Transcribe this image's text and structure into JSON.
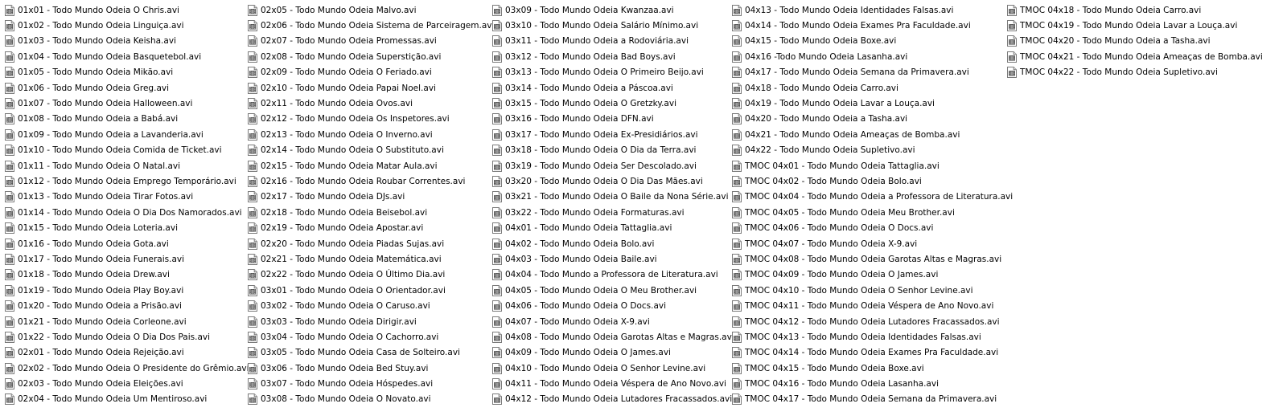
{
  "file_icon": "video-file-icon",
  "columns": [
    [
      "01x01 - Todo Mundo Odeia O Chris.avi",
      "01x02 - Todo Mundo Odeia Linguiça.avi",
      "01x03 - Todo Mundo Odeia Keisha.avi",
      "01x04 - Todo Mundo Odeia Basquetebol.avi",
      "01x05 - Todo Mundo Odeia Mikão.avi",
      "01x06 - Todo Mundo Odeia Greg.avi",
      "01x07 - Todo Mundo Odeia Halloween.avi",
      "01x08 - Todo Mundo Odeia a Babá.avi",
      "01x09 - Todo Mundo Odeia a Lavanderia.avi",
      "01x10 - Todo Mundo Odeia Comida de Ticket.avi",
      "01x11 - Todo Mundo Odeia O Natal.avi",
      "01x12 - Todo Mundo Odeia Emprego Temporário.avi",
      "01x13 - Todo Mundo Odeia Tirar Fotos.avi",
      "01x14 - Todo Mundo Odeia O Dia Dos Namorados.avi",
      "01x15 - Todo Mundo Odeia Loteria.avi",
      "01x16 - Todo Mundo Odeia Gota.avi",
      "01x17 - Todo Mundo Odeia Funerais.avi",
      "01x18 - Todo Mundo Odeia Drew.avi",
      "01x19 - Todo Mundo Odeia Play Boy.avi",
      "01x20 - Todo Mundo Odeia a Prisão.avi",
      "01x21 - Todo Mundo Odeia Corleone.avi",
      "01x22 - Todo Mundo Odeia O Dia Dos Pais.avi",
      "02x01 - Todo Mundo Odeia Rejeição.avi",
      "02x02 - Todo Mundo Odeia O Presidente do Grêmio.avi",
      "02x03 - Todo Mundo Odeia Eleições.avi",
      "02x04 - Todo Mundo Odeia Um Mentiroso.avi"
    ],
    [
      "02x05 - Todo Mundo Odeia Malvo.avi",
      "02x06 - Todo Mundo Odeia Sistema de Parceiragem.avi",
      "02x07 - Todo Mundo Odeia Promessas.avi",
      "02x08 - Todo Mundo Odeia Superstição.avi",
      "02x09 - Todo Mundo Odeia O Feriado.avi",
      "02x10 - Todo Mundo Odeia Papai Noel.avi",
      "02x11 - Todo Mundo Odeia Ovos.avi",
      "02x12 - Todo Mundo Odeia Os Inspetores.avi",
      "02x13 - Todo Mundo Odeia O Inverno.avi",
      "02x14 - Todo Mundo Odeia O Substituto.avi",
      "02x15 - Todo Mundo Odeia Matar Aula.avi",
      "02x16 - Todo Mundo Odeia Roubar Correntes.avi",
      "02x17 - Todo Mundo Odeia DJs.avi",
      "02x18 - Todo Mundo Odeia Beisebol.avi",
      "02x19 - Todo Mundo Odeia Apostar.avi",
      "02x20 - Todo Mundo Odeia Piadas Sujas.avi",
      "02x21 - Todo Mundo Odeia Matemática.avi",
      "02x22 - Todo Mundo Odeia O Último Dia.avi",
      "03x01 - Todo Mundo Odeia O Orientador.avi",
      "03x02 - Todo Mundo Odeia O Caruso.avi",
      "03x03 - Todo Mundo Odeia Dirigir.avi",
      "03x04 - Todo Mundo Odeia O Cachorro.avi",
      "03x05 - Todo Mundo Odeia Casa de Solteiro.avi",
      "03x06 - Todo Mundo Odeia Bed Stuy.avi",
      "03x07 - Todo Mundo Odeia Hóspedes.avi",
      "03x08 - Todo Mundo Odeia O Novato.avi"
    ],
    [
      "03x09 - Todo Mundo Odeia Kwanzaa.avi",
      "03x10 - Todo Mundo Odeia Salário Mínimo.avi",
      "03x11 - Todo Mundo Odeia a Rodoviária.avi",
      "03x12 - Todo Mundo Odeia Bad Boys.avi",
      "03x13 - Todo Mundo Odeia O Primeiro Beijo.avi",
      "03x14 - Todo Mundo Odeia a Páscoa.avi",
      "03x15 - Todo Mundo Odeia O Gretzky.avi",
      "03x16 - Todo Mundo Odeia DFN.avi",
      "03x17 - Todo Mundo Odeia Ex-Presidiários.avi",
      "03x18 - Todo Mundo Odeia O Dia da Terra.avi",
      "03x19 - Todo Mundo Odeia Ser Descolado.avi",
      "03x20 - Todo Mundo Odeia O Dia Das Mães.avi",
      "03x21 - Todo Mundo Odeia O Baile da Nona Série.avi",
      "03x22 - Todo Mundo Odeia Formaturas.avi",
      "04x01 - Todo Mundo Odeia Tattaglia.avi",
      "04x02 - Todo Mundo Odeia Bolo.avi",
      "04x03 - Todo Mundo Odeia Baile.avi",
      "04x04 - Todo Mundo a Professora de Literatura.avi",
      "04x05 - Todo Mundo Odeia O Meu Brother.avi",
      "04x06 - Todo Mundo Odeia O Docs.avi",
      "04x07 - Todo Mundo Odeia X-9.avi",
      "04x08 - Todo Mundo Odeia Garotas Altas e Magras.avi",
      "04x09 - Todo Mundo Odeia O James.avi",
      "04x10 - Todo Mundo Odeia O Senhor Levine.avi",
      "04x11 - Todo Mundo Odeia Véspera de Ano Novo.avi",
      "04x12 - Todo Mundo Odeia Lutadores Fracassados.avi"
    ],
    [
      "04x13 - Todo Mundo Odeia Identidades Falsas.avi",
      "04x14 - Todo Mundo Odeia Exames Pra Faculdade.avi",
      "04x15 - Todo Mundo Odeia Boxe.avi",
      "04x16 -Todo Mundo Odeia Lasanha.avi",
      "04x17 - Todo Mundo Odeia Semana da Primavera.avi",
      "04x18 - Todo Mundo Odeia Carro.avi",
      "04x19 - Todo Mundo Odeia Lavar a Louça.avi",
      "04x20 - Todo Mundo Odeia a Tasha.avi",
      "04x21 - Todo Mundo Odeia Ameaças de Bomba.avi",
      "04x22 - Todo Mundo Odeia Supletivo.avi",
      "TMOC 04x01 - Todo Mundo Odeia Tattaglia.avi",
      "TMOC 04x02 - Todo Mundo Odeia Bolo.avi",
      "TMOC 04x04 - Todo Mundo Odeia a Professora de Literatura.avi",
      "TMOC 04x05 - Todo Mundo Odeia Meu Brother.avi",
      "TMOC 04x06 - Todo Mundo Odeia O Docs.avi",
      "TMOC 04x07 - Todo Mundo Odeia X-9.avi",
      "TMOC 04x08 - Todo Mundo Odeia Garotas Altas e Magras.avi",
      "TMOC 04x09 - Todo Mundo Odeia O James.avi",
      "TMOC 04x10 - Todo Mundo Odeia O Senhor Levine.avi",
      "TMOC 04x11 - Todo Mundo Odeia Véspera de Ano Novo.avi",
      "TMOC 04x12 - Todo Mundo Odeia Lutadores Fracassados.avi",
      "TMOC 04x13 - Todo Mundo Odeia Identidades Falsas.avi",
      "TMOC 04x14 - Todo Mundo Odeia Exames Pra Faculdade.avi",
      "TMOC 04x15 - Todo Mundo Odeia Boxe.avi",
      "TMOC 04x16 - Todo Mundo Odeia Lasanha.avi",
      "TMOC 04x17 - Todo Mundo Odeia Semana da Primavera.avi"
    ],
    [
      "TMOC 04x18 - Todo Mundo Odeia Carro.avi",
      "TMOC 04x19 - Todo Mundo Odeia Lavar a Louça.avi",
      "TMOC 04x20 - Todo Mundo Odeia a Tasha.avi",
      "TMOC 04x21 - Todo Mundo Odeia Ameaças de Bomba.avi",
      "TMOC 04x22 - Todo Mundo Odeia Supletivo.avi"
    ]
  ]
}
